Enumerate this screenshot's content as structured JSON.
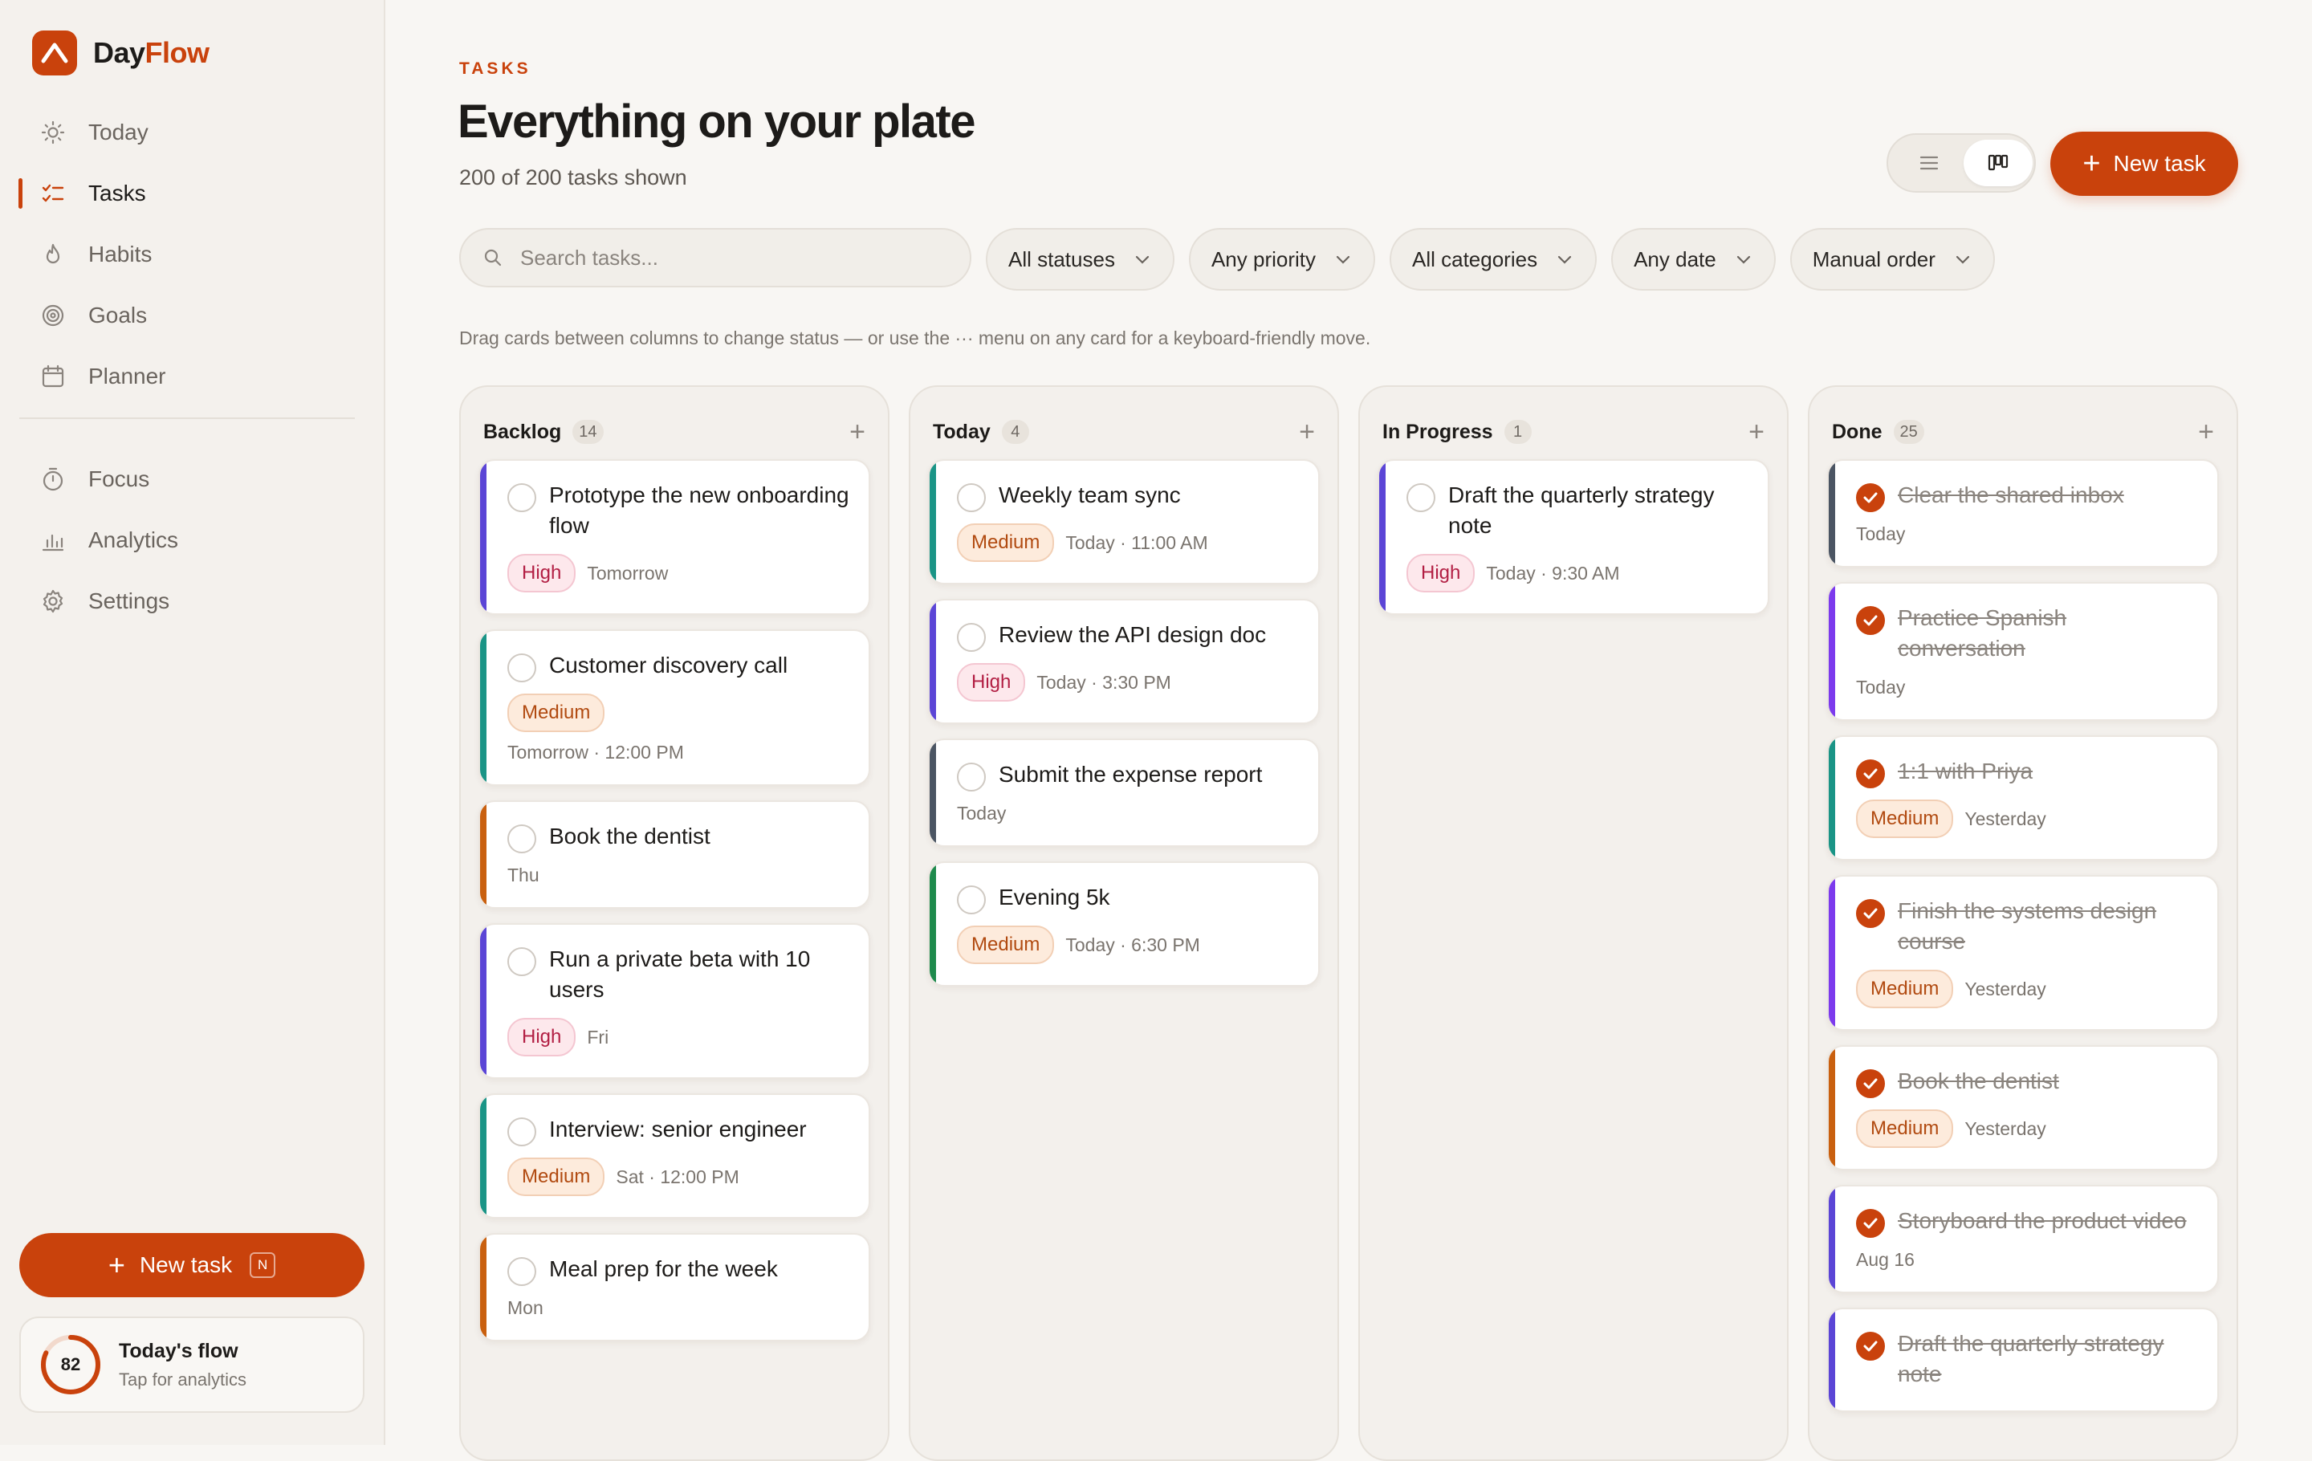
{
  "brand": {
    "name_day": "Day",
    "name_flow": "Flow",
    "accent": "#c9420c"
  },
  "nav": {
    "primary": [
      {
        "label": "Today",
        "icon": "sun-icon"
      },
      {
        "label": "Tasks",
        "icon": "checklist-icon",
        "active": true
      },
      {
        "label": "Habits",
        "icon": "flame-icon"
      },
      {
        "label": "Goals",
        "icon": "target-icon"
      },
      {
        "label": "Planner",
        "icon": "calendar-icon"
      }
    ],
    "secondary": [
      {
        "label": "Focus",
        "icon": "timer-icon"
      },
      {
        "label": "Analytics",
        "icon": "bar-chart-icon"
      },
      {
        "label": "Settings",
        "icon": "gear-icon"
      }
    ]
  },
  "sidebar_new": {
    "label": "New task",
    "shortcut": "N"
  },
  "flow": {
    "value": "82",
    "fraction": 0.82,
    "title": "Today's flow",
    "subtitle": "Tap for analytics"
  },
  "header": {
    "eyebrow": "TASKS",
    "title": "Everything on your plate",
    "subtitle": "200 of 200 tasks shown",
    "new_task": "New task"
  },
  "search": {
    "placeholder": "Search tasks..."
  },
  "filters": [
    "All statuses",
    "Any priority",
    "All categories",
    "Any date",
    "Manual order"
  ],
  "hint": "Drag cards between columns to change status — or use the ··· menu on any card for a keyboard-friendly move.",
  "columns": [
    {
      "title": "Backlog",
      "count": "14",
      "cards": [
        {
          "title": "Prototype the new onboarding flow",
          "priority": "High",
          "due": "Tomorrow",
          "accent": "#5b45d6"
        },
        {
          "title": "Customer discovery call",
          "priority": "Medium",
          "due": "Tomorrow · 12:00 PM",
          "due_separate": true,
          "accent": "#1a9486"
        },
        {
          "title": "Book the dentist",
          "priority": "",
          "due": "Thu",
          "accent": "#c9600f"
        },
        {
          "title": "Run a private beta with 10 users",
          "priority": "High",
          "due": "Fri",
          "accent": "#5b45d6"
        },
        {
          "title": "Interview: senior engineer",
          "priority": "Medium",
          "due": "Sat · 12:00 PM",
          "accent": "#1a9486"
        },
        {
          "title": "Meal prep for the week",
          "priority": "",
          "due": "Mon",
          "accent": "#c9600f"
        }
      ]
    },
    {
      "title": "Today",
      "count": "4",
      "cards": [
        {
          "title": "Weekly team sync",
          "priority": "Medium",
          "due": "Today · 11:00 AM",
          "accent": "#1a9486"
        },
        {
          "title": "Review the API design doc",
          "priority": "High",
          "due": "Today · 3:30 PM",
          "accent": "#5b45d6"
        },
        {
          "title": "Submit the expense report",
          "priority": "",
          "due": "Today",
          "accent": "#4b5563"
        },
        {
          "title": "Evening 5k",
          "priority": "Medium",
          "due": "Today · 6:30 PM",
          "accent": "#1e8a4c"
        }
      ]
    },
    {
      "title": "In Progress",
      "count": "1",
      "cards": [
        {
          "title": "Draft the quarterly strategy note",
          "priority": "High",
          "due": "Today · 9:30 AM",
          "accent": "#5b45d6"
        }
      ]
    },
    {
      "title": "Done",
      "count": "25",
      "cards": [
        {
          "title": "Clear the shared inbox",
          "priority": "",
          "due": "Today",
          "accent": "#4b5563",
          "done": true
        },
        {
          "title": "Practice Spanish conversation",
          "priority": "",
          "due": "Today",
          "accent": "#7c3aed",
          "done": true
        },
        {
          "title": "1:1 with Priya",
          "priority": "Medium",
          "due": "Yesterday",
          "accent": "#1a9486",
          "done": true
        },
        {
          "title": "Finish the systems design course",
          "priority": "Medium",
          "due": "Yesterday",
          "accent": "#7c3aed",
          "done": true
        },
        {
          "title": "Book the dentist",
          "priority": "Medium",
          "due": "Yesterday",
          "accent": "#c9600f",
          "done": true
        },
        {
          "title": "Storyboard the product video",
          "priority": "",
          "due": "Aug 16",
          "accent": "#5b45d6",
          "done": true
        },
        {
          "title": "Draft the quarterly strategy note",
          "priority": "",
          "due": "",
          "accent": "#5b45d6",
          "done": true
        }
      ]
    }
  ]
}
